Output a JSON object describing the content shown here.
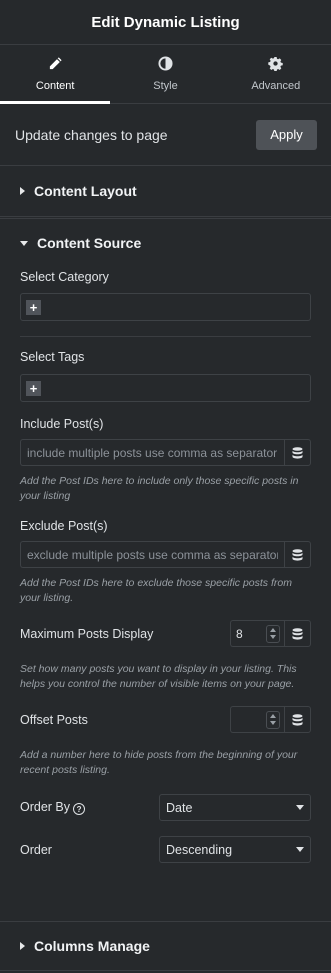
{
  "header": {
    "title": "Edit Dynamic Listing"
  },
  "tabs": [
    {
      "label": "Content",
      "icon": "pencil-icon",
      "active": true
    },
    {
      "label": "Style",
      "icon": "contrast-icon",
      "active": false
    },
    {
      "label": "Advanced",
      "icon": "gear-icon",
      "active": false
    }
  ],
  "update": {
    "text": "Update changes to page",
    "apply_label": "Apply"
  },
  "sections": {
    "content_layout": "Content Layout",
    "content_source": "Content Source",
    "columns_manage": "Columns Manage"
  },
  "fields": {
    "select_category": {
      "label": "Select Category",
      "add_symbol": "+"
    },
    "select_tags": {
      "label": "Select Tags",
      "add_symbol": "+"
    },
    "include_posts": {
      "label": "Include Post(s)",
      "placeholder": "include multiple posts use comma as separator",
      "help": "Add the Post IDs here to include only those specific posts in your listing"
    },
    "exclude_posts": {
      "label": "Exclude Post(s)",
      "placeholder": "exclude multiple posts use comma as separator",
      "help": "Add the Post IDs here to exclude those specific posts from your listing."
    },
    "max_posts": {
      "label": "Maximum Posts Display",
      "value": "8",
      "help": "Set how many posts you want to display in your listing. This helps you control the number of visible items on your page."
    },
    "offset_posts": {
      "label": "Offset Posts",
      "value": "",
      "help": "Add a number here to hide posts from the beginning of your recent posts listing."
    },
    "order_by": {
      "label": "Order By",
      "help_icon": "?",
      "value": "Date"
    },
    "order": {
      "label": "Order",
      "value": "Descending"
    }
  },
  "colors": {
    "background": "#26292c",
    "apply_button": "#4e5257",
    "border": "#3e4246"
  }
}
